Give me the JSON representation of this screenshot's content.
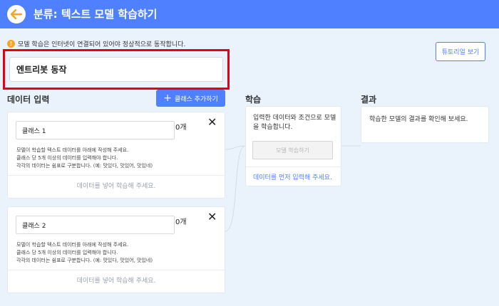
{
  "header": {
    "title": "분류: 텍스트 모델 학습하기",
    "back_icon": "arrow-left-icon"
  },
  "notice": {
    "text": "모델 학습은 인터넷이 연결되어 있어야 정상적으로 동작합니다."
  },
  "tutorial_button": "튜토리얼 보기",
  "model_name_value": "엔트리봇 동작",
  "data_input": {
    "title": "데이터 입력",
    "add_class_label": "클래스 추가하기",
    "classes": [
      {
        "name": "클래스 1",
        "count": "0개",
        "desc": [
          "모델이 학습할 텍스트 데이터를 아래에 작성해 주세요.",
          "클래스 당 5개 이상의 데이터를 입력해야 합니다.",
          "각각의 데이터는 쉼표로 구분합니다. (예: 맛있다, 맛있어, 맛있네)"
        ],
        "footer": "데이터를 넣어 학습해 주세요."
      },
      {
        "name": "클래스 2",
        "count": "0개",
        "desc": [
          "모델이 학습할 텍스트 데이터를 아래에 작성해 주세요.",
          "클래스 당 5개 이상의 데이터를 입력해야 합니다.",
          "각각의 데이터는 쉼표로 구분합니다. (예: 맛있다, 맛있어, 맛있네)"
        ],
        "footer": "데이터를 넣어 학습해 주세요."
      }
    ]
  },
  "learning": {
    "title": "학습",
    "desc": "입력한 데이터와 조건으로 모델을 학습합니다.",
    "button": "모델 학습하기",
    "link": "데이터를 먼저 입력해 주세요."
  },
  "result": {
    "title": "결과",
    "desc": "학습한 모델의 결과를 확인해 보세요."
  },
  "colors": {
    "header": "#4f80ff",
    "highlight": "#e60012",
    "background": "#eaf3fc"
  }
}
